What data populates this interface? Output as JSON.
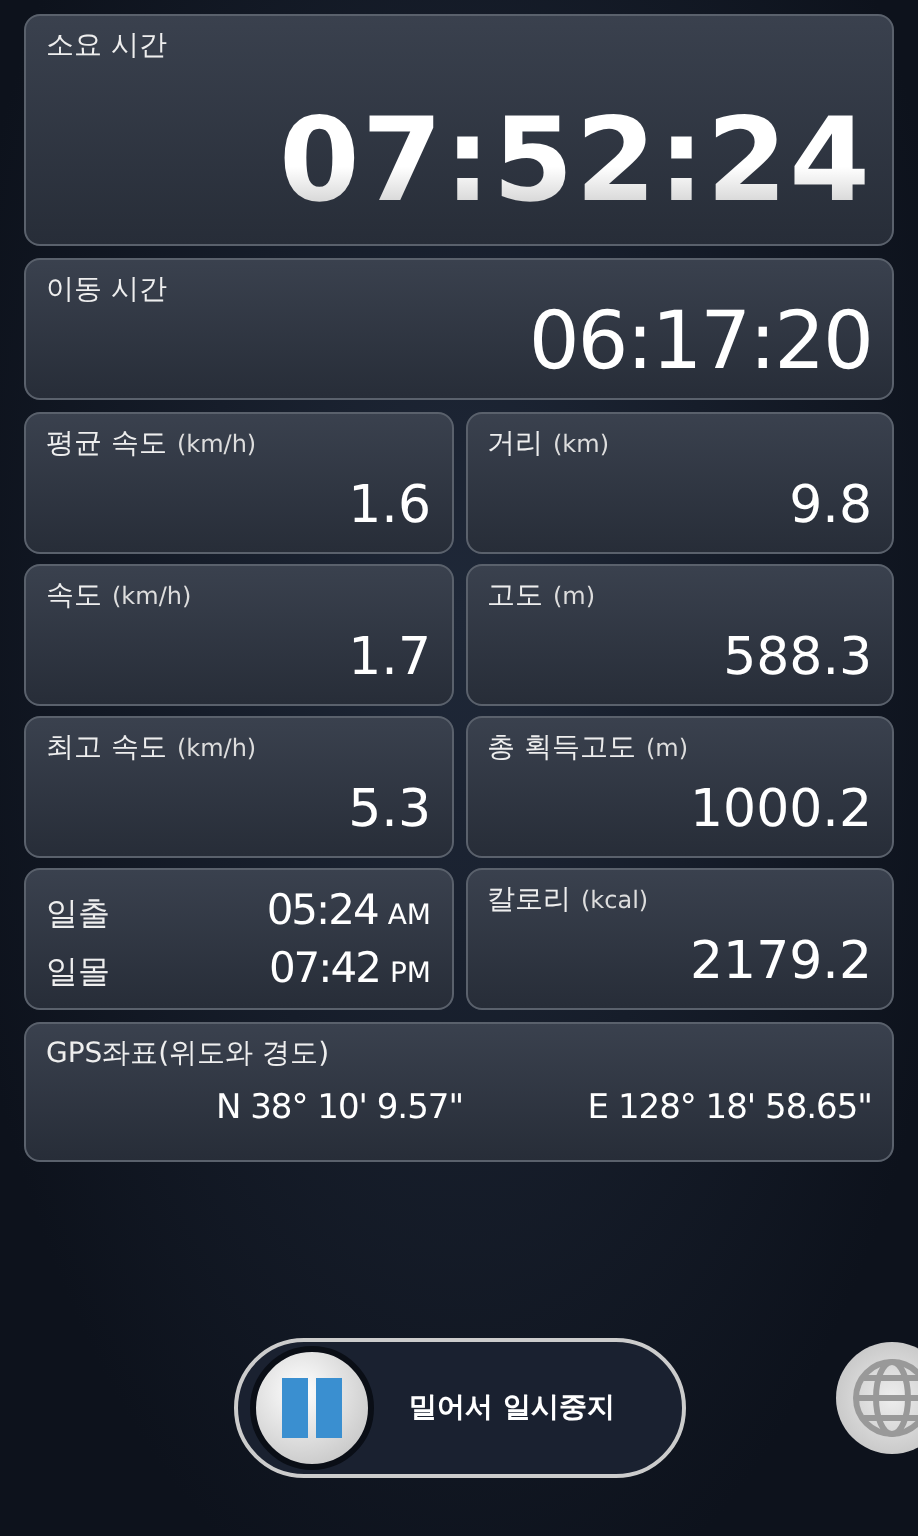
{
  "elapsed": {
    "label": "소요 시간",
    "value": "07:52:24"
  },
  "moving": {
    "label": "이동 시간",
    "value": "06:17:20"
  },
  "stats": [
    {
      "kind": "stat",
      "label": "평균 속도",
      "unit": "(km/h)",
      "value": "1.6"
    },
    {
      "kind": "stat",
      "label": "거리",
      "unit": "(km)",
      "value": "9.8"
    },
    {
      "kind": "stat",
      "label": "속도",
      "unit": "(km/h)",
      "value": "1.7"
    },
    {
      "kind": "stat",
      "label": "고도",
      "unit": "(m)",
      "value": "588.3"
    },
    {
      "kind": "stat",
      "label": "최고 속도",
      "unit": "(km/h)",
      "value": "5.3"
    },
    {
      "kind": "stat",
      "label": "총 획득고도",
      "unit": "(m)",
      "value": "1000.2"
    },
    {
      "kind": "sun",
      "rows": [
        {
          "label": "일출",
          "time": "05:24",
          "suffix": "AM"
        },
        {
          "label": "일몰",
          "time": "07:42",
          "suffix": "PM"
        }
      ]
    },
    {
      "kind": "stat",
      "label": "칼로리",
      "unit": "(kcal)",
      "value": "2179.2"
    }
  ],
  "gps": {
    "label": "GPS좌표(위도와 경도)",
    "latitude": "N 38° 10' 9.57\"",
    "longitude": "E 128° 18' 58.65\""
  },
  "pause_slider": {
    "label": "밀어서 일시중지",
    "level": 0
  }
}
